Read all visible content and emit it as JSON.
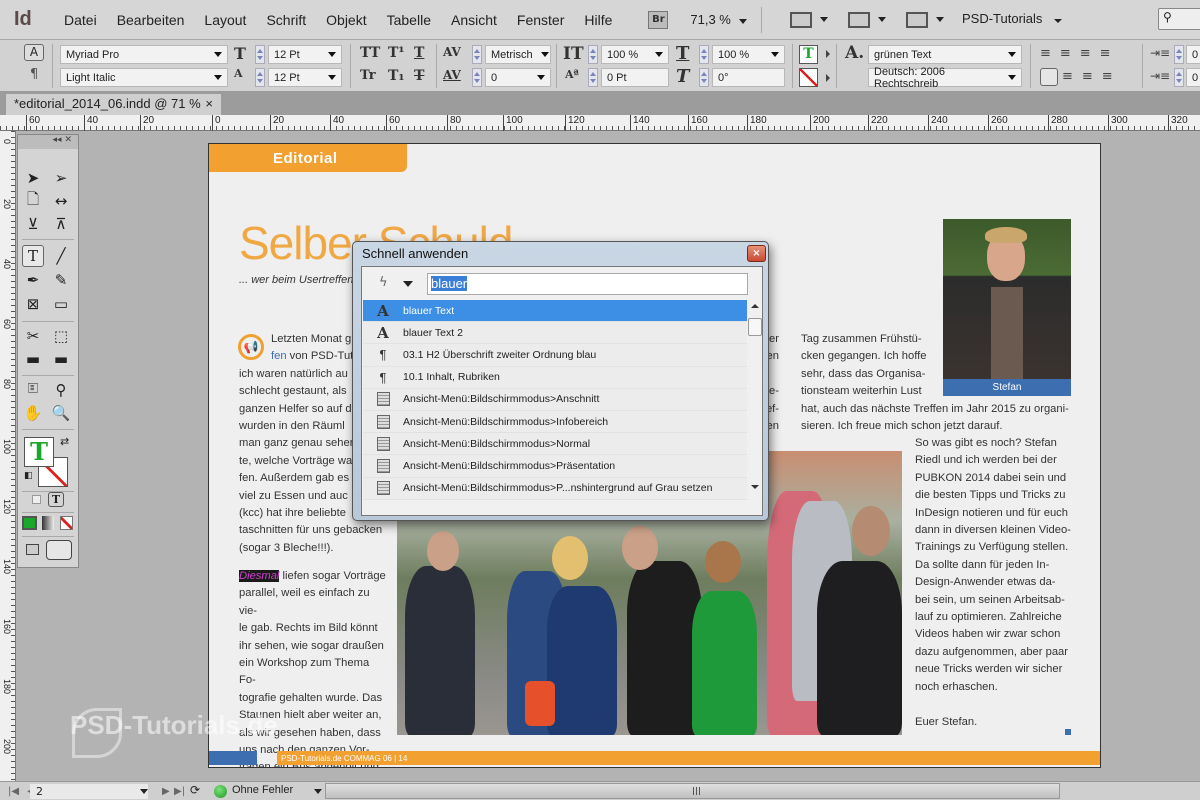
{
  "app": {
    "logo": "Id",
    "menu": [
      "Datei",
      "Bearbeiten",
      "Layout",
      "Schrift",
      "Objekt",
      "Tabelle",
      "Ansicht",
      "Fenster",
      "Hilfe"
    ],
    "bridge_label": "Br",
    "zoom": "71,3 %",
    "workspace": "PSD-Tutorials"
  },
  "control": {
    "font_family": "Myriad Pro",
    "font_style": "Light Italic",
    "font_size": "12 Pt",
    "leading": "12 Pt",
    "kerning": "Metrisch",
    "tracking": "0",
    "vertical_scale": "100 %",
    "horizontal_scale": "100 %",
    "baseline_shift": "0 Pt",
    "skew": "0°",
    "char_style": "grünen Text",
    "language": "Deutsch: 2006 Rechtschreib",
    "indent_left": "0",
    "indent_first": "0"
  },
  "document": {
    "tab_title": "*editorial_2014_06.indd @ 71 %",
    "tab_close": "×"
  },
  "rulers": {
    "h_labels": [
      "60",
      "40",
      "20",
      "0",
      "20",
      "40",
      "60",
      "80",
      "100",
      "120",
      "140",
      "160",
      "180",
      "200",
      "220",
      "240",
      "260",
      "280",
      "300",
      "320"
    ],
    "v_labels": [
      "0",
      "20",
      "40",
      "60",
      "80",
      "100",
      "120",
      "140",
      "160",
      "180",
      "200"
    ]
  },
  "page": {
    "section_tab": "Editorial",
    "headline": "Selber Schuld",
    "subline": "... wer beim Usertreffen",
    "col1_lines": [
      "Letzten Monat g",
      "fen von PSD-Tut",
      "ich waren natürlich au",
      "schlecht gestaunt, als",
      "ganzen Helfer so auf d",
      "wurden in den Räuml",
      "man ganz genau sehen",
      "te, welche Vorträge wa",
      "fen. Außerdem gab es e",
      "viel zu Essen und auc",
      "(kcc) hat ihre beliebte",
      "taschnitten für uns gebacken",
      "(sogar 3 Bleche!!!)."
    ],
    "col1b_highlight": "Diesmal",
    "col1b_lines": [
      "liefen sogar Vorträge",
      "parallel, weil es einfach zu vie-",
      "le gab. Rechts im Bild könnt",
      "ihr sehen, wie sogar draußen",
      "ein Workshop zum Thema Fo-",
      "tografie gehalten wurde. Das",
      "Staunen hielt aber weiter an,",
      "als wir gesehen haben, dass",
      "uns nach den ganzen Vor-",
      "trägen ein Bus abgeholt und"
    ],
    "col2_fragments": [
      "der",
      "hen",
      "",
      "Ge-",
      "ref-",
      "iten"
    ],
    "col3_lines": [
      "Tag zusammen Frühstü-",
      "cken gegangen. Ich hoffe",
      "sehr, dass das Organisa-",
      "tionsteam weiterhin Lust",
      "hat, auch das nächste Treffen im Jahr 2015 zu organi-",
      "sieren. Ich freue mich schon jetzt darauf."
    ],
    "col4_lines": [
      "So was gibt es noch? Stefan",
      "Riedl und ich werden bei der",
      "PUBKON 2014 dabei sein und",
      "die besten Tipps und Tricks zu",
      "InDesign notieren und für euch",
      "dann in diversen kleinen Video-",
      "Trainings zu Verfügung stellen.",
      "Da sollte dann für jeden In-",
      "Design-Anwender etwas da-",
      "bei sein, um seinen Arbeitsab-",
      "lauf zu optimieren. Zahlreiche",
      "Videos haben wir zwar schon",
      "dazu aufgenommen, aber paar",
      "neue Tricks werden wir sicher",
      "noch erhaschen.",
      "",
      "Euer Stefan."
    ],
    "photo_caption": "Stefan",
    "footer_text": "PSD-Tutorials.de   COMMAG 06 | 14",
    "colors": {
      "accent_orange": "#f2a030",
      "accent_blue": "#3d6fb0"
    }
  },
  "quick_apply": {
    "title": "Schnell anwenden",
    "close": "×",
    "query": "blauer",
    "items": [
      {
        "icon": "character-style-icon",
        "glyph": "A",
        "label": "blauer Text",
        "selected": true
      },
      {
        "icon": "character-style-icon",
        "glyph": "A",
        "label": "blauer Text 2",
        "selected": false
      },
      {
        "icon": "paragraph-style-icon",
        "glyph": "¶",
        "label": "03.1 H2 Überschrift zweiter Ordnung blau",
        "selected": false
      },
      {
        "icon": "paragraph-style-icon",
        "glyph": "¶",
        "label": "10.1 Inhalt, Rubriken",
        "selected": false
      },
      {
        "icon": "menu-command-icon",
        "glyph": "",
        "label": "Ansicht-Menü:Bildschirmmodus>Anschnitt",
        "selected": false
      },
      {
        "icon": "menu-command-icon",
        "glyph": "",
        "label": "Ansicht-Menü:Bildschirmmodus>Infobereich",
        "selected": false
      },
      {
        "icon": "menu-command-icon",
        "glyph": "",
        "label": "Ansicht-Menü:Bildschirmmodus>Normal",
        "selected": false
      },
      {
        "icon": "menu-command-icon",
        "glyph": "",
        "label": "Ansicht-Menü:Bildschirmmodus>Präsentation",
        "selected": false
      },
      {
        "icon": "menu-command-icon",
        "glyph": "",
        "label": "Ansicht-Menü:Bildschirmmodus>P...nshintergrund auf Grau setzen",
        "selected": false
      }
    ]
  },
  "status": {
    "page_number": "2",
    "preflight": "Ohne Fehler"
  },
  "watermark": "PSD-Tutorials.de"
}
